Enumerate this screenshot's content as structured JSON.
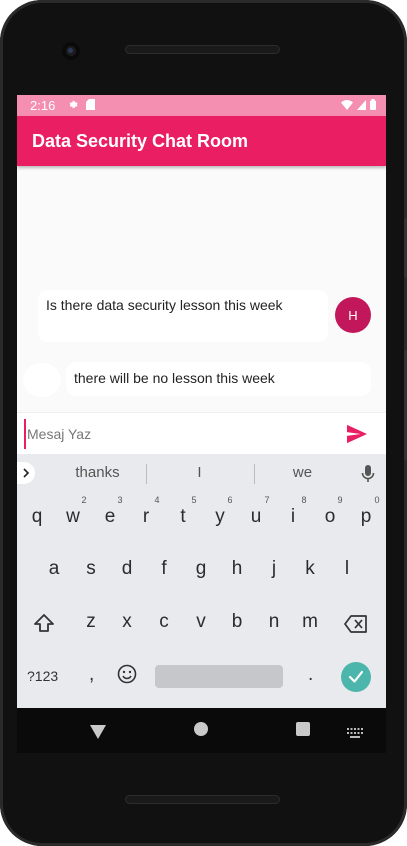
{
  "status_bar": {
    "time": "2:16",
    "settings_icon": "gear-icon",
    "sd_icon": "sd-card-icon",
    "wifi_icon": "wifi-icon",
    "signal_icon": "signal-icon",
    "battery_icon": "battery-icon"
  },
  "app_bar": {
    "title": "Data Security Chat Room"
  },
  "messages": [
    {
      "side": "right",
      "text": "Is there  data security lesson this week",
      "avatar_initial": "H"
    },
    {
      "side": "left",
      "text": "there will be no lesson this week"
    }
  ],
  "composer": {
    "placeholder": "Mesaj Yaz",
    "value": "",
    "send_icon": "send-icon"
  },
  "keyboard": {
    "suggestions": [
      "thanks",
      "I",
      "we"
    ],
    "row1": [
      "q",
      "w",
      "e",
      "r",
      "t",
      "y",
      "u",
      "i",
      "o",
      "p"
    ],
    "row1_hints": [
      "1",
      "2",
      "3",
      "4",
      "5",
      "6",
      "7",
      "8",
      "9",
      "0"
    ],
    "row2": [
      "a",
      "s",
      "d",
      "f",
      "g",
      "h",
      "j",
      "k",
      "l"
    ],
    "row3": [
      "z",
      "x",
      "c",
      "v",
      "b",
      "n",
      "m"
    ],
    "symbols_key": "?123",
    "comma_key": ",",
    "period_key": "."
  },
  "colors": {
    "primary": "#e91e63",
    "status_bar": "#f48fb1",
    "avatar": "#c2185b",
    "enter_key": "#4db6ac"
  }
}
